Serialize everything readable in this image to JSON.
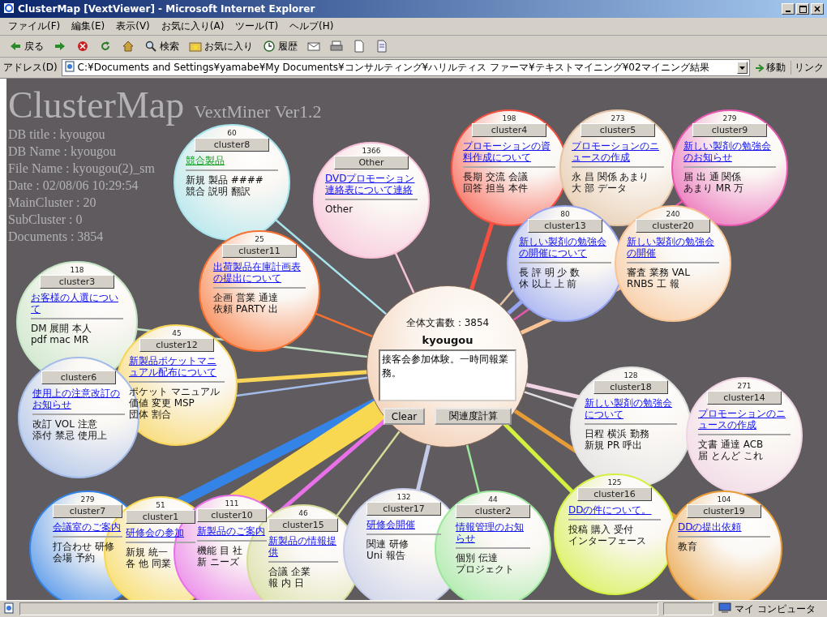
{
  "window": {
    "title": "ClusterMap [VextViewer] - Microsoft Internet Explorer"
  },
  "menu": [
    "ファイル(F)",
    "編集(E)",
    "表示(V)",
    "お気に入り(A)",
    "ツール(T)",
    "ヘルプ(H)"
  ],
  "toolbar": [
    {
      "kind": "back",
      "label": "戻る"
    },
    {
      "kind": "forward"
    },
    {
      "kind": "stop"
    },
    {
      "kind": "refresh"
    },
    {
      "kind": "home"
    },
    {
      "kind": "search",
      "label": "検索"
    },
    {
      "kind": "favorites",
      "label": "お気に入り"
    },
    {
      "kind": "history",
      "label": "履歴"
    },
    {
      "kind": "mail"
    },
    {
      "kind": "print"
    },
    {
      "kind": "edit"
    },
    {
      "kind": "discuss"
    }
  ],
  "address": {
    "label": "アドレス(D)",
    "value": "C:¥Documents and Settings¥yamabe¥My Documents¥コンサルティング¥ハリルティス ファーマ¥テキストマイニング¥02マイニング結果",
    "go": "移動",
    "links": "リンク"
  },
  "header": {
    "title": "ClusterMap",
    "subtitle": "VextMiner Ver1.2",
    "info": [
      "DB title : kyougou",
      "DB Name : kyougou",
      "File Name : kyougou(2)_sm",
      "Date : 02/08/06 10:29:54",
      "MainCluster : 20",
      "SubCluster : 0",
      "Documents : 3854"
    ]
  },
  "center": {
    "count": "全体文書数：3854",
    "name": "kyougou",
    "query": "接客会参加体験。一時同報業務。",
    "buttons": [
      "Clear",
      "関連度計算"
    ]
  },
  "clusters": [
    {
      "name": "cluster8",
      "count": "60",
      "link": "競合製品",
      "visited": true,
      "summary": [
        "新規 製品 ####",
        "競合 説明 翻訳"
      ],
      "color": "#a8e4ec",
      "kind": "thin"
    },
    {
      "name": "Other",
      "count": "1366",
      "link": "DVDプロモーション連絡表について連絡",
      "visited": false,
      "summary": [
        "Other"
      ],
      "color": "#f8c0d8",
      "kind": "thin"
    },
    {
      "name": "cluster11",
      "count": "25",
      "link": "出荷製品在庫計画表の提出について",
      "visited": false,
      "summary": [
        "企画 営業 通達",
        "依頼 PARTY 出"
      ],
      "color": "#f87030",
      "kind": "thin"
    },
    {
      "name": "cluster4",
      "count": "198",
      "link": "プロモーションの資料作成について",
      "visited": false,
      "summary": [
        "長期 交流 会議",
        "回答 担当 本件"
      ],
      "color": "#f85040",
      "kind": "medium"
    },
    {
      "name": "cluster5",
      "count": "273",
      "link": "プロモーションのニュースの作成",
      "visited": false,
      "summary": [
        "永 昌 関係 あまり",
        "大 部 データ"
      ],
      "color": "#e4c4a4",
      "kind": "thin"
    },
    {
      "name": "cluster9",
      "count": "279",
      "link": "新しい製剤の勉強会のお知らせ",
      "visited": false,
      "summary": [
        "届 出 通 関係",
        "あまり MR 万"
      ],
      "color": "#e858b0",
      "kind": "thin"
    },
    {
      "name": "cluster13",
      "count": "80",
      "link": "新しい製剤の勉強会の開催について",
      "visited": false,
      "summary": [
        "長 評 明 少 数",
        "休 以上 上 前"
      ],
      "color": "#94a4f0",
      "kind": "medium"
    },
    {
      "name": "cluster20",
      "count": "240",
      "link": "新しい製剤の勉強会の開催",
      "visited": false,
      "summary": [
        "審査 業務 VAL",
        "RNBS 工 報"
      ],
      "color": "#f8c494",
      "kind": "medium"
    },
    {
      "name": "cluster3",
      "count": "118",
      "link": "お客様の人選について",
      "visited": false,
      "summary": [
        "DM 展開 本人",
        "pdf mac MR"
      ],
      "color": "#c4e4c4",
      "kind": "thin"
    },
    {
      "name": "cluster12",
      "count": "45",
      "link": "新製品ポケットマニュアル配布について",
      "visited": false,
      "summary": [
        "ポケット マニュアル",
        "価値 変更 MSP",
        "団体 割合"
      ],
      "color": "#f8d458",
      "kind": "medium"
    },
    {
      "name": "cluster6",
      "link": "使用上の注意改訂のお知らせ",
      "visited": false,
      "summary": [
        "改訂 VOL 注意",
        "添付 禁忌 使用上"
      ],
      "color": "#a4bce8",
      "kind": "thin"
    },
    {
      "name": "cluster18",
      "count": "128",
      "link": "新しい製剤の勉強会について",
      "visited": false,
      "summary": [
        "日程 横浜 勤務",
        "新規 PR 呼出"
      ],
      "color": "#e0e0e0",
      "kind": "thin"
    },
    {
      "name": "cluster14",
      "count": "271",
      "link": "プロモーションのニュースの作成",
      "visited": false,
      "summary": [
        "文書 通達 ACB",
        "届 とんど これ"
      ],
      "color": "#f0d4e4",
      "kind": "medium"
    },
    {
      "name": "cluster7",
      "count": "279",
      "link": "会議室のご案内",
      "visited": false,
      "summary": [
        "打合わせ 研修",
        "会場 予約"
      ],
      "color": "#3484e8",
      "kind": "thick"
    },
    {
      "name": "cluster1",
      "count": "51",
      "link": "研修会の参加",
      "visited": false,
      "summary": [
        "新規 統一",
        "各 他 同業"
      ],
      "color": "#f8d850",
      "kind": "band"
    },
    {
      "name": "cluster10",
      "count": "111",
      "link": "新製品のご案内",
      "visited": false,
      "summary": [
        "機能 目 社",
        "新 ニーズ"
      ],
      "color": "#e870e8",
      "kind": "medium"
    },
    {
      "name": "cluster15",
      "count": "46",
      "link": "新製品の情報提供",
      "visited": false,
      "summary": [
        "合議 企業",
        "報 内 日"
      ],
      "color": "#d4dc98",
      "kind": "thin"
    },
    {
      "name": "cluster17",
      "count": "132",
      "link": "研修会開催",
      "visited": false,
      "summary": [
        "関連 研修",
        "Uni 報告"
      ],
      "color": "#c4cce8",
      "kind": "medium"
    },
    {
      "name": "cluster2",
      "count": "44",
      "link": "情報管理のお知らせ",
      "visited": false,
      "summary": [
        "個別 伝達",
        "プロジェクト"
      ],
      "color": "#9ce89c",
      "kind": "thin"
    },
    {
      "name": "cluster16",
      "count": "125",
      "link": "DDの件について。",
      "visited": false,
      "summary": [
        "投稿 購入 受付",
        "インターフェース"
      ],
      "color": "#d4f040",
      "kind": "medium"
    },
    {
      "name": "cluster19",
      "count": "104",
      "link": "DDの提出依頼",
      "visited": false,
      "summary": [
        "教育"
      ],
      "color": "#e89c38",
      "kind": "medium"
    }
  ],
  "status_bar": {
    "zone": "マイ コンピュータ"
  }
}
